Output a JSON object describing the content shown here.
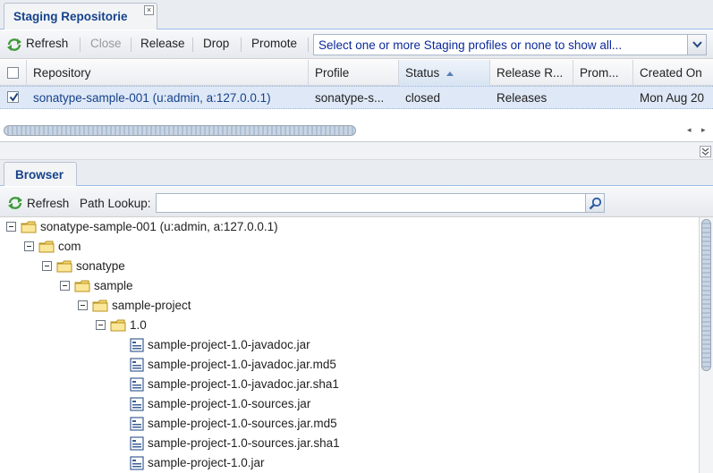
{
  "top_tab": {
    "title": "Staging Repositorie",
    "close": "×"
  },
  "toolbar": {
    "refresh": "Refresh",
    "close": "Close",
    "release": "Release",
    "drop": "Drop",
    "promote": "Promote",
    "profile_select": "Select one or more Staging profiles or none to show all..."
  },
  "grid": {
    "columns": [
      "Repository",
      "Profile",
      "Status",
      "Release R...",
      "Prom...",
      "Created On"
    ],
    "sorted_column": "Status",
    "sort_direction": "ascending",
    "rows": [
      {
        "checked": true,
        "repository": "sonatype-sample-001 (u:admin, a:127.0.0.1)",
        "profile": "sonatype-s...",
        "status": "closed",
        "release_repository": "Releases",
        "promotion": "",
        "created_on": "Mon Aug 20"
      }
    ]
  },
  "browser": {
    "tab": "Browser",
    "refresh": "Refresh",
    "path_lookup_label": "Path Lookup:",
    "path_lookup_value": "",
    "tree": [
      {
        "label": "sonatype-sample-001 (u:admin, a:127.0.0.1)",
        "type": "folder"
      },
      {
        "label": "com",
        "type": "folder"
      },
      {
        "label": "sonatype",
        "type": "folder"
      },
      {
        "label": "sample",
        "type": "folder"
      },
      {
        "label": "sample-project",
        "type": "folder"
      },
      {
        "label": "1.0",
        "type": "folder"
      },
      {
        "label": "sample-project-1.0-javadoc.jar",
        "type": "file"
      },
      {
        "label": "sample-project-1.0-javadoc.jar.md5",
        "type": "file"
      },
      {
        "label": "sample-project-1.0-javadoc.jar.sha1",
        "type": "file"
      },
      {
        "label": "sample-project-1.0-sources.jar",
        "type": "file"
      },
      {
        "label": "sample-project-1.0-sources.jar.md5",
        "type": "file"
      },
      {
        "label": "sample-project-1.0-sources.jar.sha1",
        "type": "file"
      },
      {
        "label": "sample-project-1.0.jar",
        "type": "file"
      }
    ]
  },
  "colors": {
    "accent": "#15428b",
    "selection": "#dfe8f6",
    "link": "#15428b",
    "folder": "#f3d160"
  }
}
